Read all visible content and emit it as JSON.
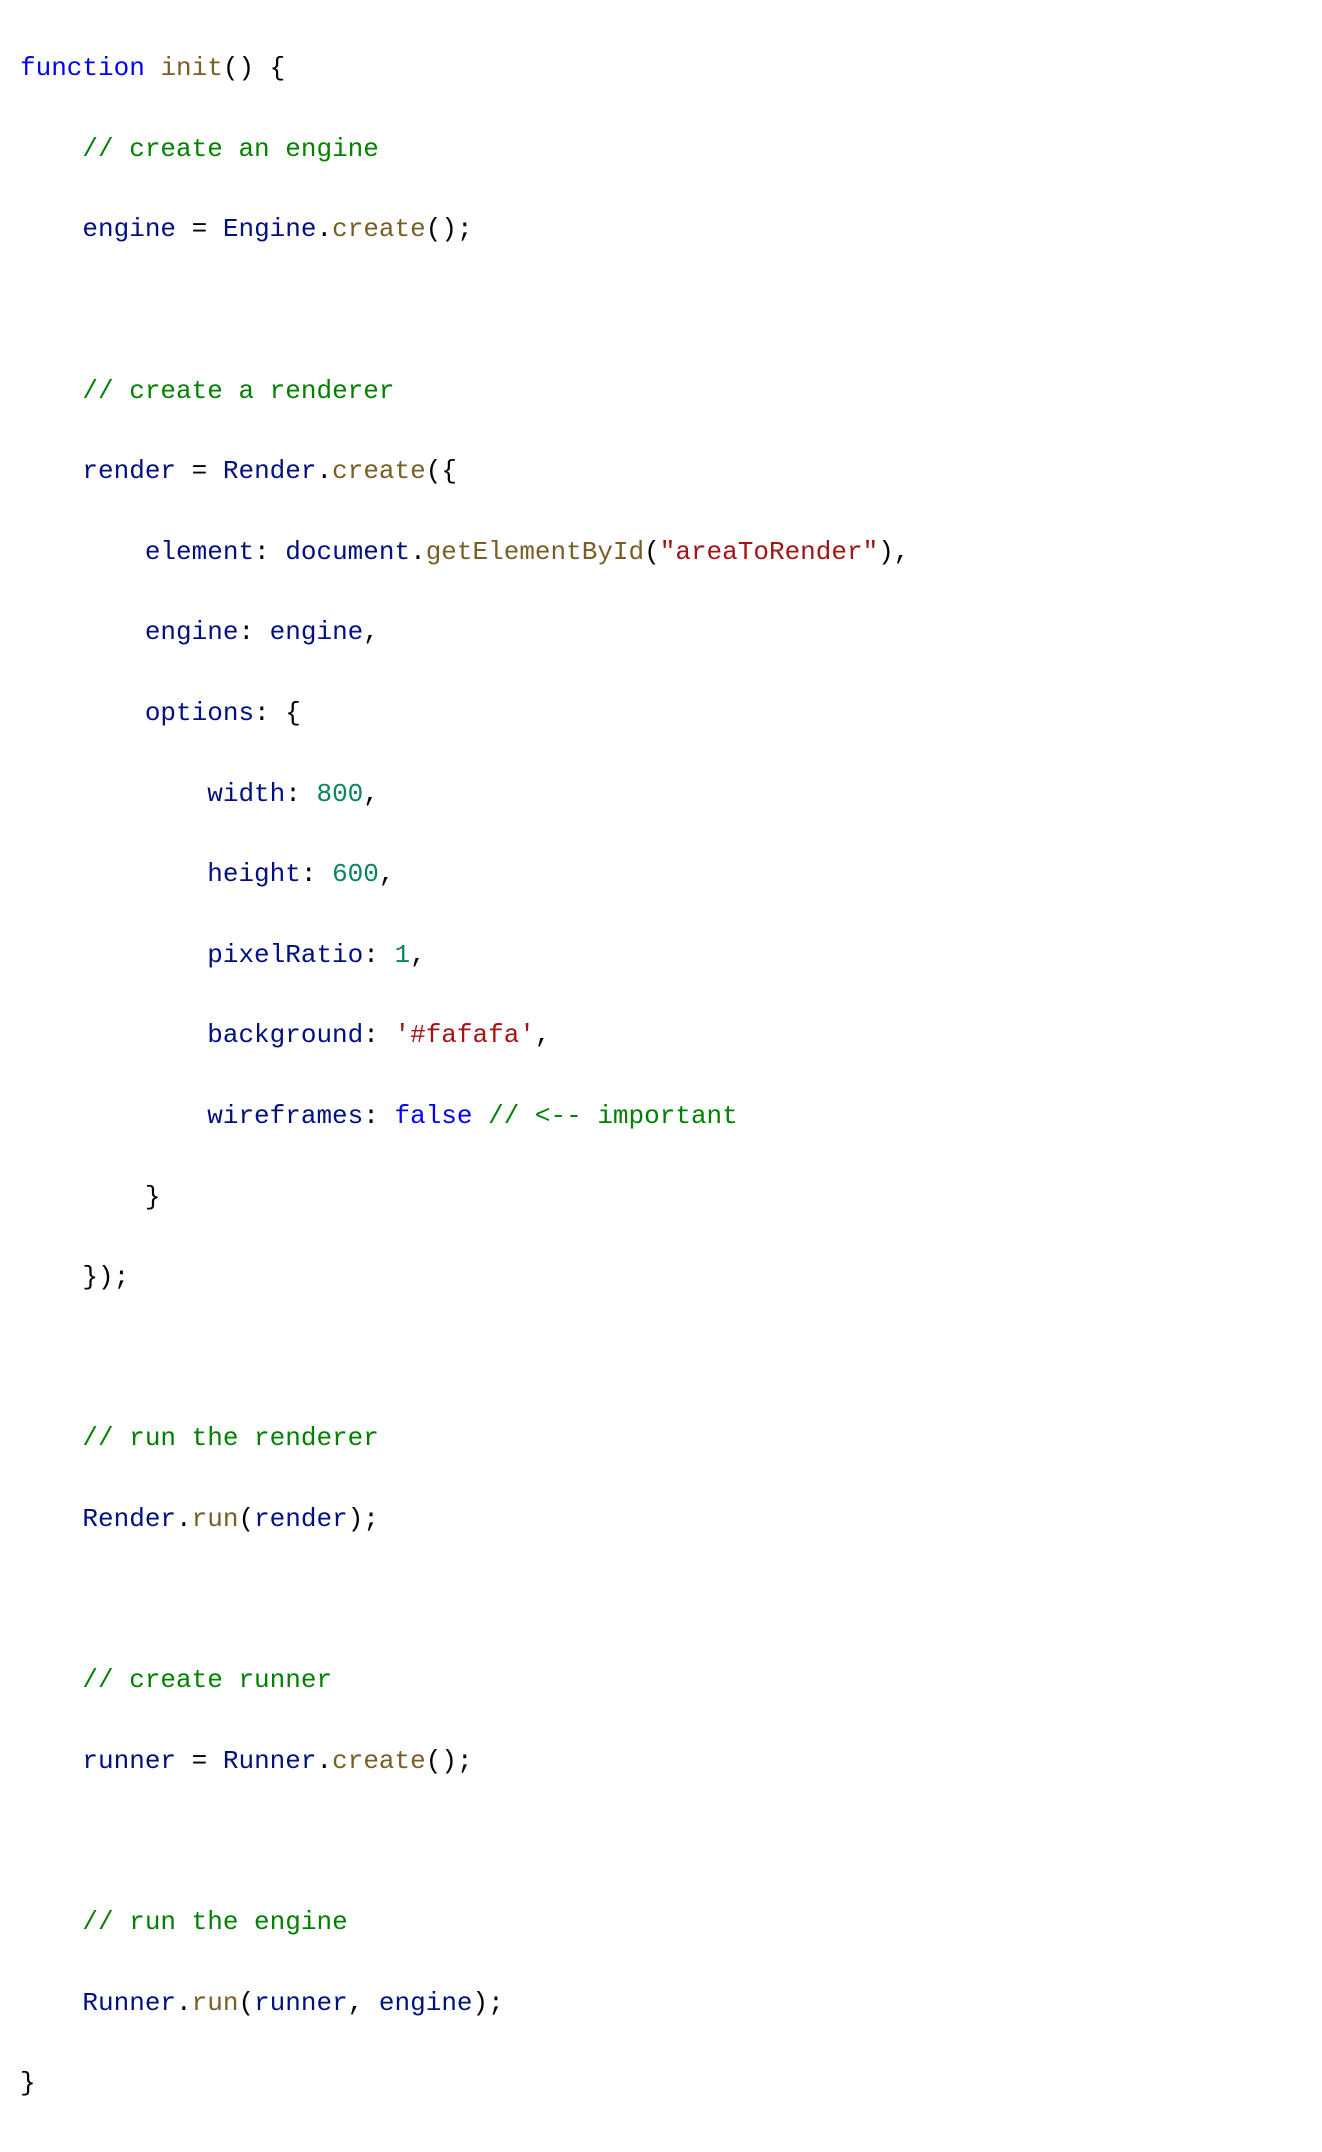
{
  "code": {
    "keyword_function": "function",
    "fn_init": "init",
    "comment_engine": "// create an engine",
    "var_engine": "engine",
    "obj_Engine": "Engine",
    "fn_create": "create",
    "comment_renderer": "// create a renderer",
    "var_render": "render",
    "obj_Render": "Render",
    "prop_element": "element",
    "obj_document": "document",
    "fn_getElementById": "getElementById",
    "str_areaToRender": "\"areaToRender\"",
    "prop_engine": "engine",
    "prop_options": "options",
    "prop_width": "width",
    "num_800": "800",
    "prop_height": "height",
    "num_600": "600",
    "prop_pixelRatio": "pixelRatio",
    "num_1": "1",
    "prop_background": "background",
    "str_fafafa": "'#fafafa'",
    "prop_wireframes": "wireframes",
    "lit_false": "false",
    "comment_important": "// <-- important",
    "comment_run_renderer": "// run the renderer",
    "fn_run": "run",
    "comment_create_runner": "// create runner",
    "var_runner": "runner",
    "obj_Runner": "Runner",
    "comment_run_engine": "// run the engine"
  }
}
